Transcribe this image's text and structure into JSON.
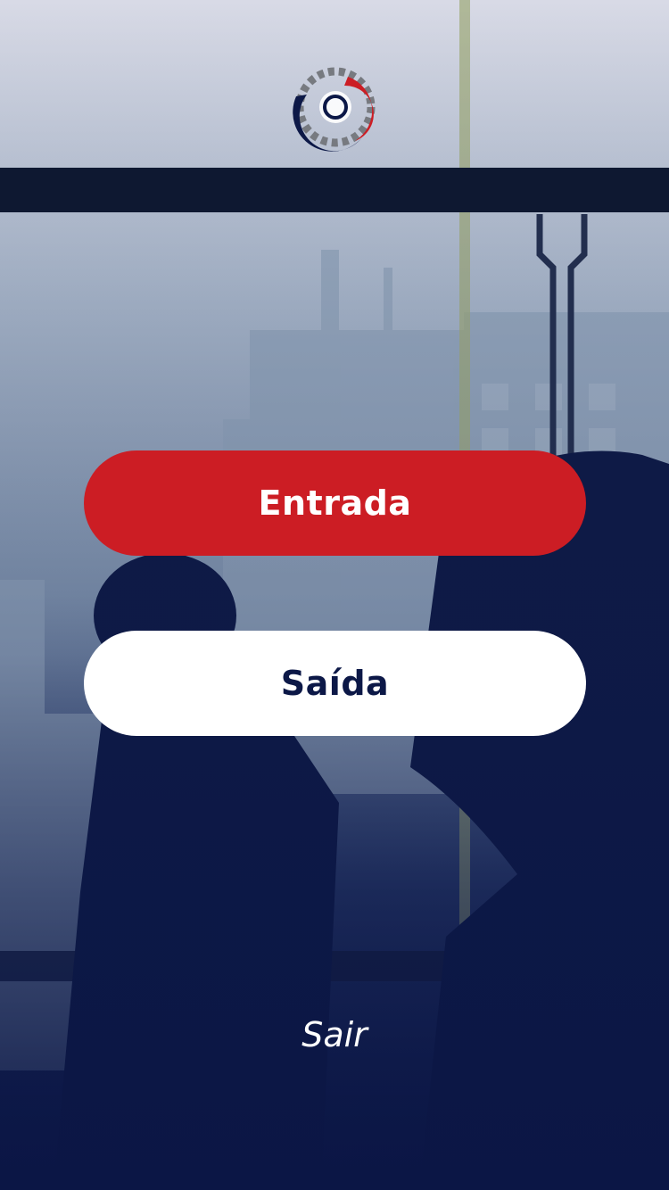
{
  "buttons": {
    "entrada_label": "Entrada",
    "saida_label": "Saída"
  },
  "footer": {
    "sair_label": "Sair"
  },
  "colors": {
    "primary_red": "#cc1d24",
    "navy": "#0c1847",
    "white": "#ffffff"
  },
  "logo": {
    "icon": "gear-swirl-logo"
  }
}
